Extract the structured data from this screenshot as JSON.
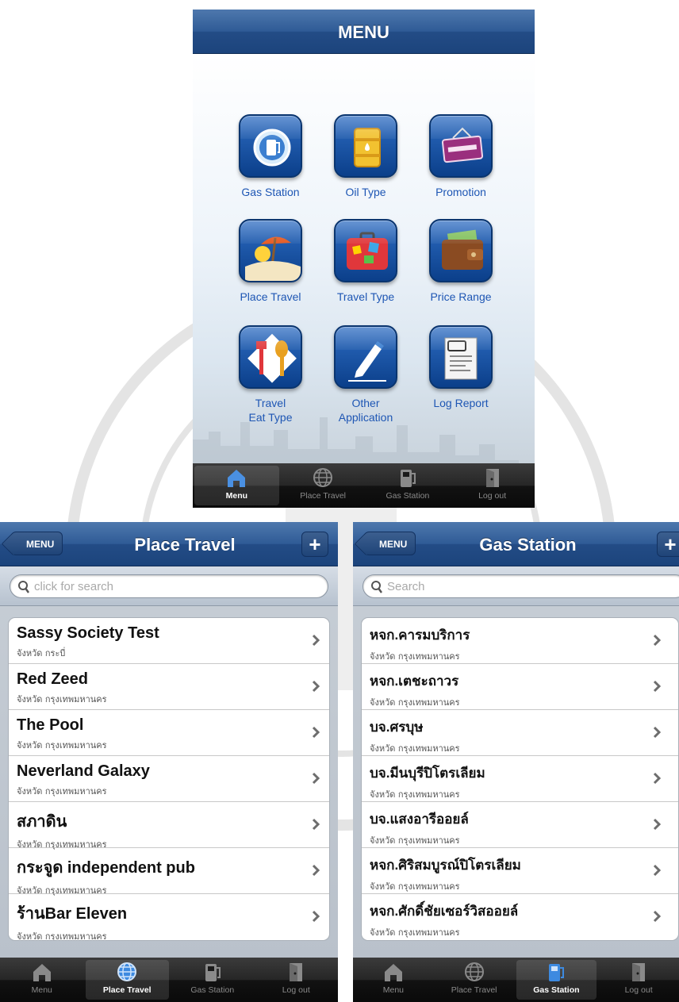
{
  "menu_screen": {
    "title": "MENU",
    "items": [
      {
        "label": "Gas Station",
        "icon": "gas-pump-icon"
      },
      {
        "label": "Oil Type",
        "icon": "oil-barrel-icon"
      },
      {
        "label": "Promotion",
        "icon": "promotion-sign-icon"
      },
      {
        "label": "Place Travel",
        "icon": "beach-umbrella-icon"
      },
      {
        "label": "Travel Type",
        "icon": "suitcase-icon"
      },
      {
        "label": "Price Range",
        "icon": "wallet-icon"
      },
      {
        "label": "Travel\nEat Type",
        "icon": "fork-spoon-icon"
      },
      {
        "label": "Other\nApplication",
        "icon": "pen-icon"
      },
      {
        "label": "Log Report",
        "icon": "log-document-icon"
      }
    ]
  },
  "tabbar": {
    "tabs": [
      {
        "label": "Menu",
        "icon": "home-icon"
      },
      {
        "label": "Place Travel",
        "icon": "globe-icon"
      },
      {
        "label": "Gas Station",
        "icon": "gas-pump-icon"
      },
      {
        "label": "Log out",
        "icon": "door-icon"
      }
    ]
  },
  "place_travel_screen": {
    "back_label": "MENU",
    "title": "Place Travel",
    "add_label": "+",
    "search_placeholder": "click for search",
    "active_tab": "Place Travel",
    "rows": [
      {
        "title": "Sassy  Society Test",
        "subtitle": "จังหวัด กระบี่"
      },
      {
        "title": "Red Zeed",
        "subtitle": "จังหวัด กรุงเทพมหานคร"
      },
      {
        "title": "The Pool",
        "subtitle": "จังหวัด กรุงเทพมหานคร"
      },
      {
        "title": "Neverland Galaxy",
        "subtitle": "จังหวัด กรุงเทพมหานคร"
      },
      {
        "title": "สภาดิน",
        "subtitle": "จังหวัด กรุงเทพมหานคร"
      },
      {
        "title": "กระจูด independent pub",
        "subtitle": "จังหวัด กรุงเทพมหานคร"
      },
      {
        "title": "ร้านBar Eleven",
        "subtitle": "จังหวัด กรุงเทพมหานคร"
      }
    ]
  },
  "gas_station_screen": {
    "back_label": "MENU",
    "title": "Gas Station",
    "add_label": "+",
    "search_placeholder": "Search",
    "active_tab": "Gas Station",
    "rows": [
      {
        "title": "หจก.คารมบริการ",
        "subtitle": "จังหวัด กรุงเทพมหานคร"
      },
      {
        "title": "หจก.เตชะถาวร",
        "subtitle": "จังหวัด กรุงเทพมหานคร"
      },
      {
        "title": "บจ.ศรบุษ",
        "subtitle": "จังหวัด กรุงเทพมหานคร"
      },
      {
        "title": "บจ.มีนบุรีปิโตรเลียม",
        "subtitle": "จังหวัด กรุงเทพมหานคร"
      },
      {
        "title": "บจ.แสงอารีออยล์",
        "subtitle": "จังหวัด กรุงเทพมหานคร"
      },
      {
        "title": "หจก.ศิริสมบูรณ์ปิโตรเลียม",
        "subtitle": "จังหวัด กรุงเทพมหานคร"
      },
      {
        "title": "หจก.ศักดิ์ชัยเซอร์วิสออยล์",
        "subtitle": "จังหวัด กรุงเทพมหานคร"
      }
    ]
  },
  "colors": {
    "navbar_blue": "#2f5b96",
    "menu_label_blue": "#1e56b4",
    "icon_blue": "#0b3f8a",
    "tabbar_dark": "#1a1a1a",
    "list_background": "#c5ccd4"
  }
}
